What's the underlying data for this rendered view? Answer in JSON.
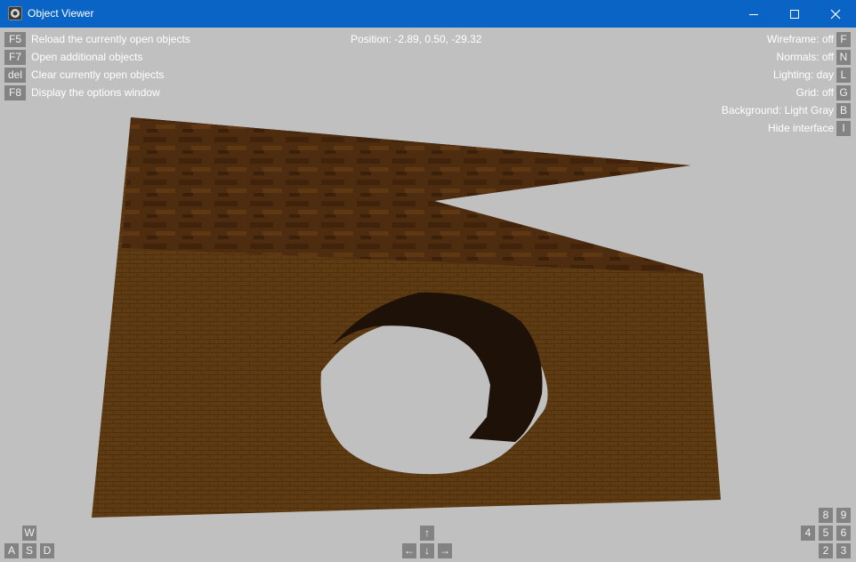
{
  "window": {
    "title": "Object Viewer",
    "controls": [
      "minimize",
      "maximize",
      "close"
    ]
  },
  "commands": [
    {
      "key": "F5",
      "label": "Reload the currently open objects"
    },
    {
      "key": "F7",
      "label": "Open additional objects"
    },
    {
      "key": "del",
      "label": "Clear currently open objects"
    },
    {
      "key": "F8",
      "label": "Display the options window"
    }
  ],
  "position": "Position: -2.89, 0.50, -29.32",
  "settings": [
    {
      "label": "Wireframe: off",
      "key": "F"
    },
    {
      "label": "Normals: off",
      "key": "N"
    },
    {
      "label": "Lighting: day",
      "key": "L"
    },
    {
      "label": "Grid: off",
      "key": "G"
    },
    {
      "label": "Background: Light Gray",
      "key": "B"
    },
    {
      "label": "Hide interface",
      "key": "I"
    }
  ],
  "movement_keys": {
    "w": "W",
    "a": "A",
    "s": "S",
    "d": "D"
  },
  "arrow_keys": {
    "up": "↑",
    "left": "←",
    "down": "↓",
    "right": "→"
  },
  "numpad_keys": {
    "k8": "8",
    "k9": "9",
    "k4": "4",
    "k5": "5",
    "k6": "6",
    "k2": "2",
    "k3": "3"
  },
  "colors": {
    "titlebar": "#0a64c6",
    "background": "#c0c0c0",
    "key_button": "#838383",
    "wood_face": "#5e3b12",
    "wood_top": "#4a2a10",
    "hole_shadow": "#1e1208"
  }
}
